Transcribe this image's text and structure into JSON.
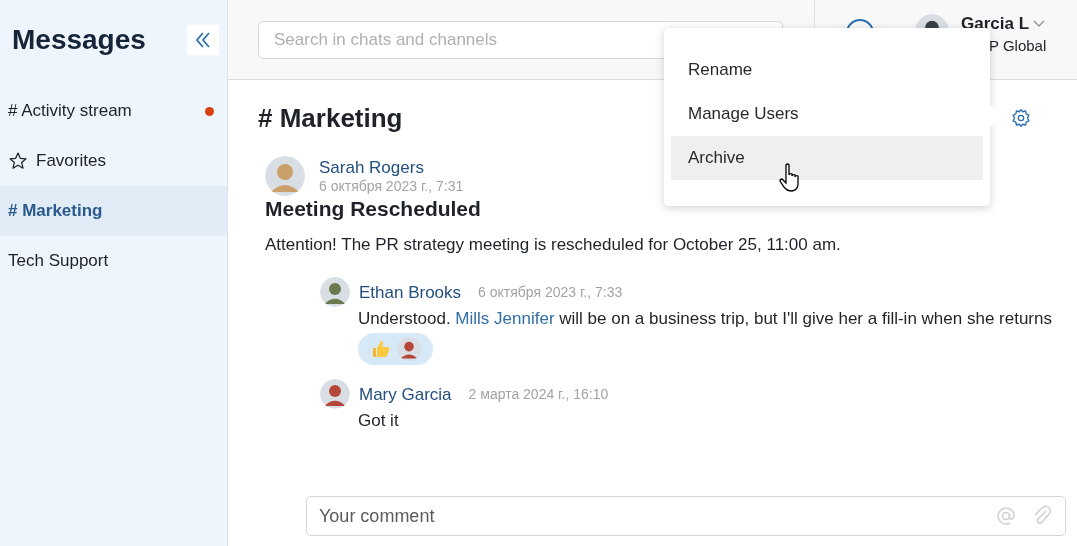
{
  "sidebar": {
    "title": "Messages",
    "items": [
      {
        "label": "# Activity stream",
        "kind": "channel",
        "selected": false,
        "unread": true
      },
      {
        "label": "Favorites",
        "kind": "favorites",
        "selected": false,
        "unread": false
      },
      {
        "label": "# Marketing",
        "kind": "channel",
        "selected": true,
        "unread": false
      },
      {
        "label": "Tech Support",
        "kind": "plain",
        "selected": false,
        "unread": false
      }
    ]
  },
  "header": {
    "search": {
      "placeholder": "Search in chats and channels"
    },
    "user": {
      "name": "Garcia L",
      "company": "P Global"
    }
  },
  "chat": {
    "title": "# Marketing",
    "post": {
      "author": "Sarah Rogers",
      "date": "6 октября 2023 г., 7:31",
      "title": "Meeting Rescheduled",
      "body": "Attention! The PR strategy meeting is rescheduled for October 25, 11:00 am."
    },
    "replies": [
      {
        "author": "Ethan Brooks",
        "date": "6 октября 2023 г., 7:33",
        "parts": [
          {
            "kind": "text",
            "text": "Understood. "
          },
          {
            "kind": "mention",
            "text": "Mills Jennifer"
          },
          {
            "kind": "text",
            "text": " will be on a business trip, but I'll give her a fill-in when she returns"
          }
        ],
        "reactions": true
      },
      {
        "author": "Mary Garcia",
        "date": "2 марта 2024 г., 16:10",
        "parts": [
          {
            "kind": "text",
            "text": "Got it"
          }
        ],
        "reactions": false
      }
    ],
    "comment": {
      "placeholder": "Your comment"
    }
  },
  "menu": {
    "items": [
      {
        "label": "Rename",
        "selected": false
      },
      {
        "label": "Manage Users",
        "selected": false
      },
      {
        "label": "Archive",
        "selected": true
      }
    ]
  }
}
